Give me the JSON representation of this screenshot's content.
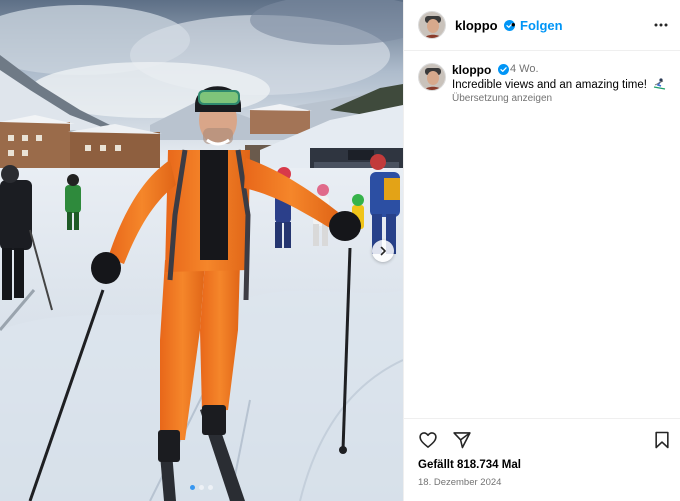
{
  "post": {
    "username": "kloppo",
    "follow_label": "Folgen",
    "separator": "•",
    "caption": {
      "username": "kloppo",
      "time_ago": "4 Wo.",
      "text": "Incredible views and an amazing time!",
      "translate_label": "Übersetzung anzeigen"
    },
    "likes_text": "Gefällt 818.734 Mal",
    "date_text": "18. Dezember 2024",
    "carousel": {
      "slides": 3,
      "active_index": 0
    }
  },
  "colors": {
    "link_blue": "#0095f6",
    "verified_blue": "#0095f6",
    "muted_text": "#737373",
    "ski_suit": "#f07a1a"
  },
  "icons": {
    "verified": "verified-badge-icon",
    "more": "more-options-icon",
    "like": "heart-icon",
    "share": "paper-plane-icon",
    "save": "bookmark-icon",
    "next": "chevron-right-icon"
  }
}
